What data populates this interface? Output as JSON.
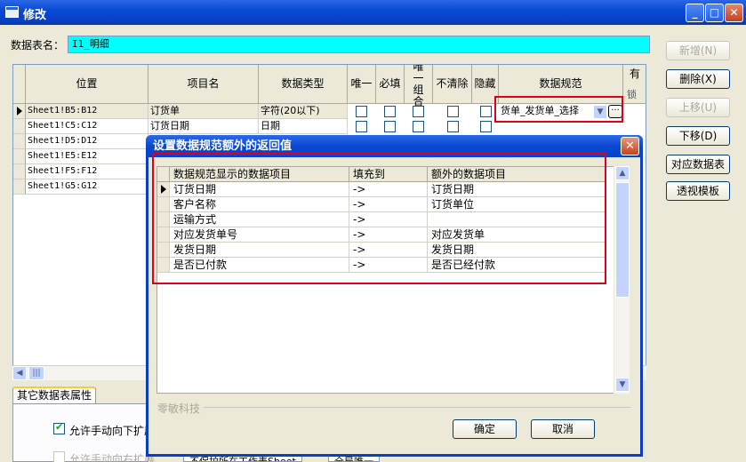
{
  "window": {
    "title": "修改",
    "minimize": "_",
    "maximize": "□",
    "close": "✕"
  },
  "table_name": {
    "label": "数据表名：",
    "value": "I1_明细"
  },
  "grid": {
    "columns": [
      "位置",
      "项目名",
      "数据类型",
      "唯一",
      "必填",
      "唯一组合",
      "不清除",
      "隐藏",
      "数据规范",
      "有"
    ],
    "extra_header": "锁",
    "rows": [
      {
        "pos": "Sheet1!B5:B12",
        "name": "订货单",
        "type": "字符(20以下)",
        "spec": "货单_发货单_选择"
      },
      {
        "pos": "Sheet1!C5:C12",
        "name": "订货日期",
        "type": "日期",
        "spec": ""
      },
      {
        "pos": "Sheet1!D5:D12",
        "name": "",
        "type": "",
        "spec": ""
      },
      {
        "pos": "Sheet1!E5:E12",
        "name": "",
        "type": "",
        "spec": ""
      },
      {
        "pos": "Sheet1!F5:F12",
        "name": "",
        "type": "",
        "spec": ""
      },
      {
        "pos": "Sheet1!G5:G12",
        "name": "",
        "type": "",
        "spec": ""
      }
    ],
    "spec_button": "···"
  },
  "buttons": {
    "new": "新增(N)",
    "delete": "删除(X)",
    "up": "上移(U)",
    "down": "下移(D)",
    "map": "对应数据表",
    "pivot": "透视模板"
  },
  "tab": {
    "label": "其它数据表属性"
  },
  "options": {
    "allow_down": "允许手动向下扩展",
    "allow_right": "允许手动向右扩展",
    "protect": "不保护所在工作表Sheet",
    "global_unique": "全局唯一"
  },
  "dialog": {
    "title": "设置数据规范额外的返回值",
    "close": "✕",
    "columns": [
      "数据规范显示的数据项目",
      "填充到",
      "额外的数据项目"
    ],
    "rows": [
      {
        "item": "订货日期",
        "to": "->",
        "extra": "订货日期"
      },
      {
        "item": "客户名称",
        "to": "->",
        "extra": "订货单位"
      },
      {
        "item": "运输方式",
        "to": "->",
        "extra": ""
      },
      {
        "item": "对应发货单号",
        "to": "->",
        "extra": "对应发货单"
      },
      {
        "item": "发货日期",
        "to": "->",
        "extra": "发货日期"
      },
      {
        "item": "是否已付款",
        "to": "->",
        "extra": "是否已经付款"
      }
    ],
    "company": "零敏科技",
    "ok": "确定",
    "cancel": "取消"
  },
  "colors": {
    "highlight": "#00ffff",
    "annotation": "#e0001a",
    "title_bar": "#0a48d2"
  }
}
